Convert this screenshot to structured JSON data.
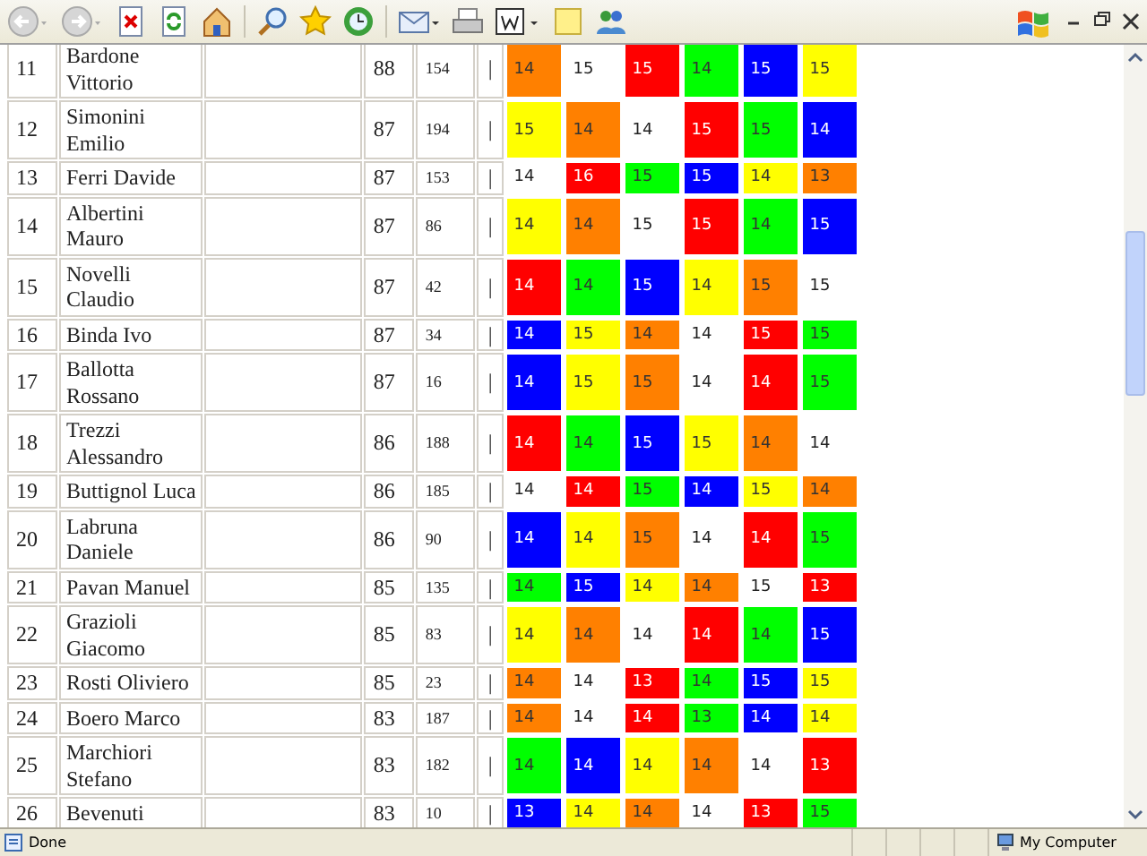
{
  "rows": [
    {
      "rank": "11",
      "name": [
        "Bardone",
        "Vittorio"
      ],
      "score": "88",
      "count": "154",
      "sep": "|",
      "cells": [
        {
          "value": "14",
          "color": "#ff8000"
        },
        {
          "value": "15",
          "color": "#ffffff"
        },
        {
          "value": "15",
          "color": "#ff0000"
        },
        {
          "value": "14",
          "color": "#00ff00"
        },
        {
          "value": "15",
          "color": "#0000ff"
        },
        {
          "value": "15",
          "color": "#ffff00"
        }
      ]
    },
    {
      "rank": "12",
      "name": [
        "Simonini",
        "Emilio"
      ],
      "score": "87",
      "count": "194",
      "sep": "|",
      "cells": [
        {
          "value": "15",
          "color": "#ffff00"
        },
        {
          "value": "14",
          "color": "#ff8000"
        },
        {
          "value": "14",
          "color": "#ffffff"
        },
        {
          "value": "15",
          "color": "#ff0000"
        },
        {
          "value": "15",
          "color": "#00ff00"
        },
        {
          "value": "14",
          "color": "#0000ff"
        }
      ]
    },
    {
      "rank": "13",
      "name": [
        "Ferri Davide"
      ],
      "score": "87",
      "count": "153",
      "sep": "|",
      "cells": [
        {
          "value": "14",
          "color": "#ffffff"
        },
        {
          "value": "16",
          "color": "#ff0000"
        },
        {
          "value": "15",
          "color": "#00ff00"
        },
        {
          "value": "15",
          "color": "#0000ff"
        },
        {
          "value": "14",
          "color": "#ffff00"
        },
        {
          "value": "13",
          "color": "#ff8000"
        }
      ]
    },
    {
      "rank": "14",
      "name": [
        "Albertini",
        "Mauro"
      ],
      "score": "87",
      "count": "86",
      "sep": "|",
      "cells": [
        {
          "value": "14",
          "color": "#ffff00"
        },
        {
          "value": "14",
          "color": "#ff8000"
        },
        {
          "value": "15",
          "color": "#ffffff"
        },
        {
          "value": "15",
          "color": "#ff0000"
        },
        {
          "value": "14",
          "color": "#00ff00"
        },
        {
          "value": "15",
          "color": "#0000ff"
        }
      ]
    },
    {
      "rank": "15",
      "name": [
        "Novelli",
        "Claudio"
      ],
      "score": "87",
      "count": "42",
      "sep": "|",
      "cells": [
        {
          "value": "14",
          "color": "#ff0000"
        },
        {
          "value": "14",
          "color": "#00ff00"
        },
        {
          "value": "15",
          "color": "#0000ff"
        },
        {
          "value": "14",
          "color": "#ffff00"
        },
        {
          "value": "15",
          "color": "#ff8000"
        },
        {
          "value": "15",
          "color": "#ffffff"
        }
      ]
    },
    {
      "rank": "16",
      "name": [
        "Binda Ivo"
      ],
      "score": "87",
      "count": "34",
      "sep": "|",
      "cells": [
        {
          "value": "14",
          "color": "#0000ff"
        },
        {
          "value": "15",
          "color": "#ffff00"
        },
        {
          "value": "14",
          "color": "#ff8000"
        },
        {
          "value": "14",
          "color": "#ffffff"
        },
        {
          "value": "15",
          "color": "#ff0000"
        },
        {
          "value": "15",
          "color": "#00ff00"
        }
      ]
    },
    {
      "rank": "17",
      "name": [
        "Ballotta",
        "Rossano"
      ],
      "score": "87",
      "count": "16",
      "sep": "|",
      "cells": [
        {
          "value": "14",
          "color": "#0000ff"
        },
        {
          "value": "15",
          "color": "#ffff00"
        },
        {
          "value": "15",
          "color": "#ff8000"
        },
        {
          "value": "14",
          "color": "#ffffff"
        },
        {
          "value": "14",
          "color": "#ff0000"
        },
        {
          "value": "15",
          "color": "#00ff00"
        }
      ]
    },
    {
      "rank": "18",
      "name": [
        "Trezzi",
        "Alessandro"
      ],
      "score": "86",
      "count": "188",
      "sep": "|",
      "cells": [
        {
          "value": "14",
          "color": "#ff0000"
        },
        {
          "value": "14",
          "color": "#00ff00"
        },
        {
          "value": "15",
          "color": "#0000ff"
        },
        {
          "value": "15",
          "color": "#ffff00"
        },
        {
          "value": "14",
          "color": "#ff8000"
        },
        {
          "value": "14",
          "color": "#ffffff"
        }
      ]
    },
    {
      "rank": "19",
      "name": [
        "Buttignol Luca"
      ],
      "score": "86",
      "count": "185",
      "sep": "|",
      "cells": [
        {
          "value": "14",
          "color": "#ffffff"
        },
        {
          "value": "14",
          "color": "#ff0000"
        },
        {
          "value": "15",
          "color": "#00ff00"
        },
        {
          "value": "14",
          "color": "#0000ff"
        },
        {
          "value": "15",
          "color": "#ffff00"
        },
        {
          "value": "14",
          "color": "#ff8000"
        }
      ]
    },
    {
      "rank": "20",
      "name": [
        "Labruna",
        "Daniele"
      ],
      "score": "86",
      "count": "90",
      "sep": "|",
      "cells": [
        {
          "value": "14",
          "color": "#0000ff"
        },
        {
          "value": "14",
          "color": "#ffff00"
        },
        {
          "value": "15",
          "color": "#ff8000"
        },
        {
          "value": "14",
          "color": "#ffffff"
        },
        {
          "value": "14",
          "color": "#ff0000"
        },
        {
          "value": "15",
          "color": "#00ff00"
        }
      ]
    },
    {
      "rank": "21",
      "name": [
        "Pavan Manuel"
      ],
      "score": "85",
      "count": "135",
      "sep": "|",
      "cells": [
        {
          "value": "14",
          "color": "#00ff00"
        },
        {
          "value": "15",
          "color": "#0000ff"
        },
        {
          "value": "14",
          "color": "#ffff00"
        },
        {
          "value": "14",
          "color": "#ff8000"
        },
        {
          "value": "15",
          "color": "#ffffff"
        },
        {
          "value": "13",
          "color": "#ff0000"
        }
      ]
    },
    {
      "rank": "22",
      "name": [
        "Grazioli",
        "Giacomo"
      ],
      "score": "85",
      "count": "83",
      "sep": "|",
      "cells": [
        {
          "value": "14",
          "color": "#ffff00"
        },
        {
          "value": "14",
          "color": "#ff8000"
        },
        {
          "value": "14",
          "color": "#ffffff"
        },
        {
          "value": "14",
          "color": "#ff0000"
        },
        {
          "value": "14",
          "color": "#00ff00"
        },
        {
          "value": "15",
          "color": "#0000ff"
        }
      ]
    },
    {
      "rank": "23",
      "name": [
        "Rosti Oliviero"
      ],
      "score": "85",
      "count": "23",
      "sep": "|",
      "cells": [
        {
          "value": "14",
          "color": "#ff8000"
        },
        {
          "value": "14",
          "color": "#ffffff"
        },
        {
          "value": "13",
          "color": "#ff0000"
        },
        {
          "value": "14",
          "color": "#00ff00"
        },
        {
          "value": "15",
          "color": "#0000ff"
        },
        {
          "value": "15",
          "color": "#ffff00"
        }
      ]
    },
    {
      "rank": "24",
      "name": [
        "Boero Marco"
      ],
      "score": "83",
      "count": "187",
      "sep": "|",
      "cells": [
        {
          "value": "14",
          "color": "#ff8000"
        },
        {
          "value": "14",
          "color": "#ffffff"
        },
        {
          "value": "14",
          "color": "#ff0000"
        },
        {
          "value": "13",
          "color": "#00ff00"
        },
        {
          "value": "14",
          "color": "#0000ff"
        },
        {
          "value": "14",
          "color": "#ffff00"
        }
      ]
    },
    {
      "rank": "25",
      "name": [
        "Marchiori",
        "Stefano"
      ],
      "score": "83",
      "count": "182",
      "sep": "|",
      "cells": [
        {
          "value": "14",
          "color": "#00ff00"
        },
        {
          "value": "14",
          "color": "#0000ff"
        },
        {
          "value": "14",
          "color": "#ffff00"
        },
        {
          "value": "14",
          "color": "#ff8000"
        },
        {
          "value": "14",
          "color": "#ffffff"
        },
        {
          "value": "13",
          "color": "#ff0000"
        }
      ]
    },
    {
      "rank": "26",
      "name": [
        "Bevenuti"
      ],
      "score": "83",
      "count": "10",
      "sep": "|",
      "cells": [
        {
          "value": "13",
          "color": "#0000ff"
        },
        {
          "value": "14",
          "color": "#ffff00"
        },
        {
          "value": "14",
          "color": "#ff8000"
        },
        {
          "value": "14",
          "color": "#ffffff"
        },
        {
          "value": "13",
          "color": "#ff0000"
        },
        {
          "value": "15",
          "color": "#00ff00"
        }
      ]
    }
  ],
  "status_bar": {
    "left": "Done",
    "right": "My Computer"
  }
}
